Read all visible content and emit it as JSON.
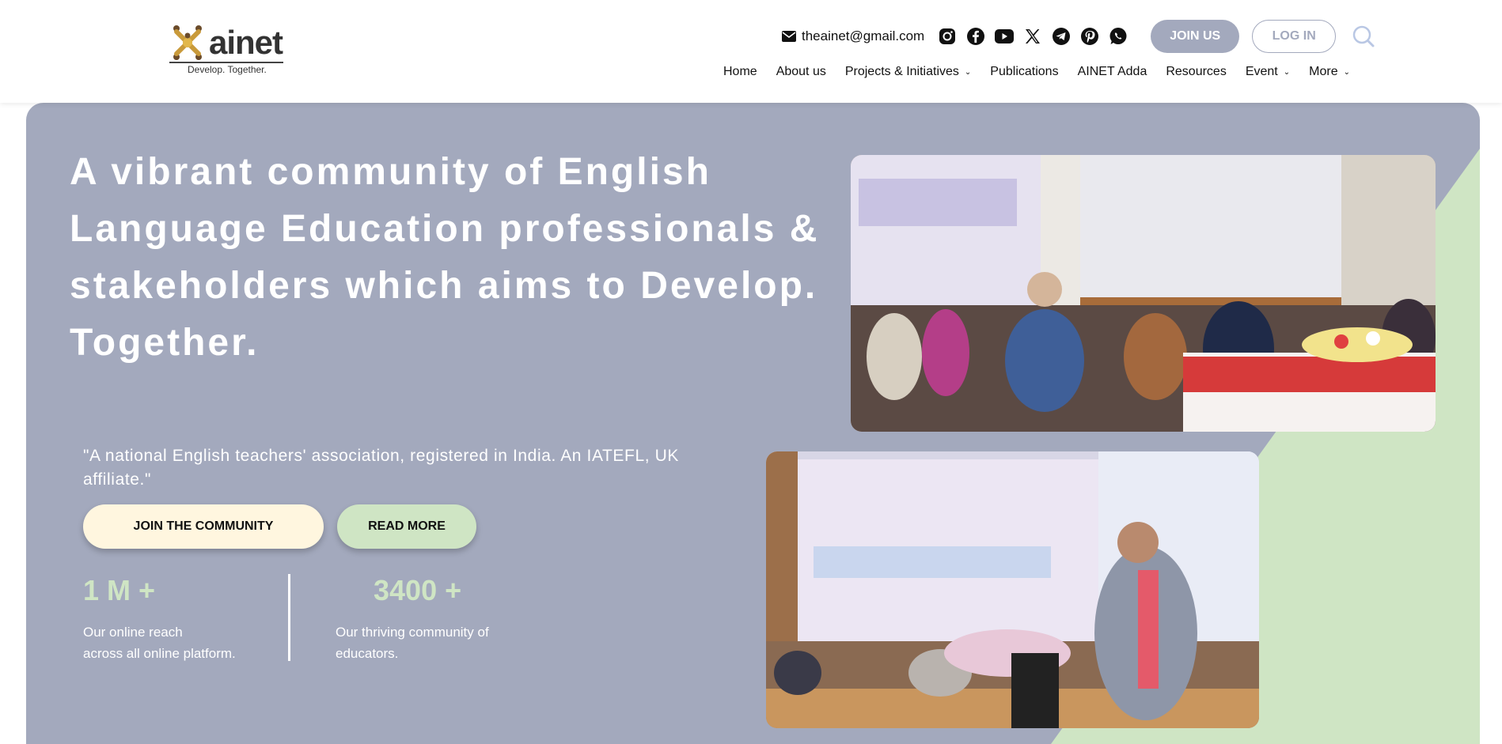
{
  "logo": {
    "name": "ainet",
    "tagline": "Develop. Together."
  },
  "topbar": {
    "email": "theainet@gmail.com",
    "socials": [
      "instagram-icon",
      "facebook-icon",
      "youtube-icon",
      "x-icon",
      "telegram-icon",
      "pinterest-icon",
      "whatsapp-icon"
    ],
    "join_label": "JOIN US",
    "login_label": "LOG IN"
  },
  "nav": {
    "items": [
      {
        "label": "Home",
        "dropdown": false
      },
      {
        "label": "About us",
        "dropdown": false
      },
      {
        "label": "Projects & Initiatives",
        "dropdown": true
      },
      {
        "label": "Publications",
        "dropdown": false
      },
      {
        "label": "AINET Adda",
        "dropdown": false
      },
      {
        "label": "Resources",
        "dropdown": false
      },
      {
        "label": "Event",
        "dropdown": true
      },
      {
        "label": "More",
        "dropdown": true
      }
    ]
  },
  "hero": {
    "headline": "A vibrant community of English Language Education professionals & stakeholders which aims to Develop. Together.",
    "quote": "\"A national English teachers' association, registered in India. An IATEFL, UK affiliate.\"",
    "cta_join": "JOIN THE COMMUNITY",
    "cta_read": "READ MORE",
    "stats": [
      {
        "number": "1 M +",
        "line1": "Our online reach",
        "line2": "across all online platform."
      },
      {
        "number": "3400 +",
        "line1": "Our thriving community of",
        "line2": "educators."
      }
    ]
  },
  "colors": {
    "hero_bg": "#a3a9bd",
    "accent_green": "#cfe5c4",
    "cream": "#fff6df"
  }
}
